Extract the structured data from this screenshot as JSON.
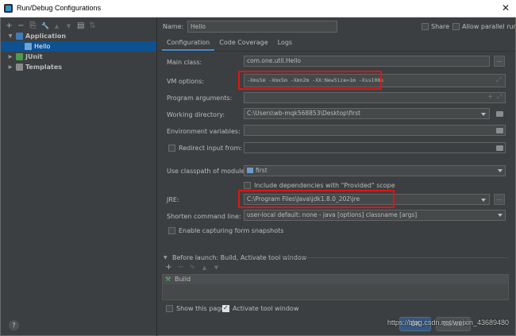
{
  "window": {
    "title": "Run/Debug Configurations",
    "close_glyph": "✕"
  },
  "toolbar": {
    "add": "+",
    "remove": "−",
    "copy": "⎘",
    "edit": "🔧",
    "up": "▲",
    "down": "▼",
    "folder": "▤",
    "sort": "⇅"
  },
  "tree": {
    "application": "Application",
    "hello": "Hello",
    "junit": "JUnit",
    "templates": "Templates"
  },
  "header": {
    "name_label": "Name:",
    "name_value": "Hello",
    "share_label": "Share",
    "allow_parallel_label": "Allow parallel run"
  },
  "tabs": [
    "Configuration",
    "Code Coverage",
    "Logs"
  ],
  "form": {
    "main_class_label": "Main class:",
    "main_class_value": "com.one.util.Hello",
    "vm_options_label": "VM options:",
    "vm_options_value": "-Xms5m -Xmx5m -Xmn2m -XX:NewSize=1m -Xss108k",
    "program_args_label": "Program arguments:",
    "program_args_value": "",
    "working_dir_label": "Working directory:",
    "working_dir_value": "C:\\Users\\wb-mqk568853\\Desktop\\first",
    "env_vars_label": "Environment variables:",
    "env_vars_value": "",
    "redirect_label": "Redirect input from:",
    "classpath_label": "Use classpath of module:",
    "classpath_value": "first",
    "include_deps_label": "Include dependencies with \"Provided\" scope",
    "jre_label": "JRE:",
    "jre_value": "C:\\Program Files\\Java\\jdk1.8.0_202\\jre",
    "shorten_label": "Shorten command line:",
    "shorten_value": "user-local default: none - java [options] classname [args]",
    "form_snapshots_label": "Enable capturing form snapshots"
  },
  "before_launch": {
    "header": "Before launch: Build, Activate tool window",
    "add": "+",
    "remove": "−",
    "edit": "✎",
    "up": "▲",
    "down": "▼",
    "item": "Build",
    "show_page_label": "Show this page",
    "activate_window_label": "Activate tool window"
  },
  "footer": {
    "help": "?",
    "ok": "OK",
    "cancel": "Cancel",
    "watermark": "https://blog.csdn.net/weixin_43689480"
  },
  "colors": {
    "background": "#3c3f41",
    "selection": "#0d5191",
    "highlight_box": "#e11414",
    "accent": "#4a88c7"
  }
}
